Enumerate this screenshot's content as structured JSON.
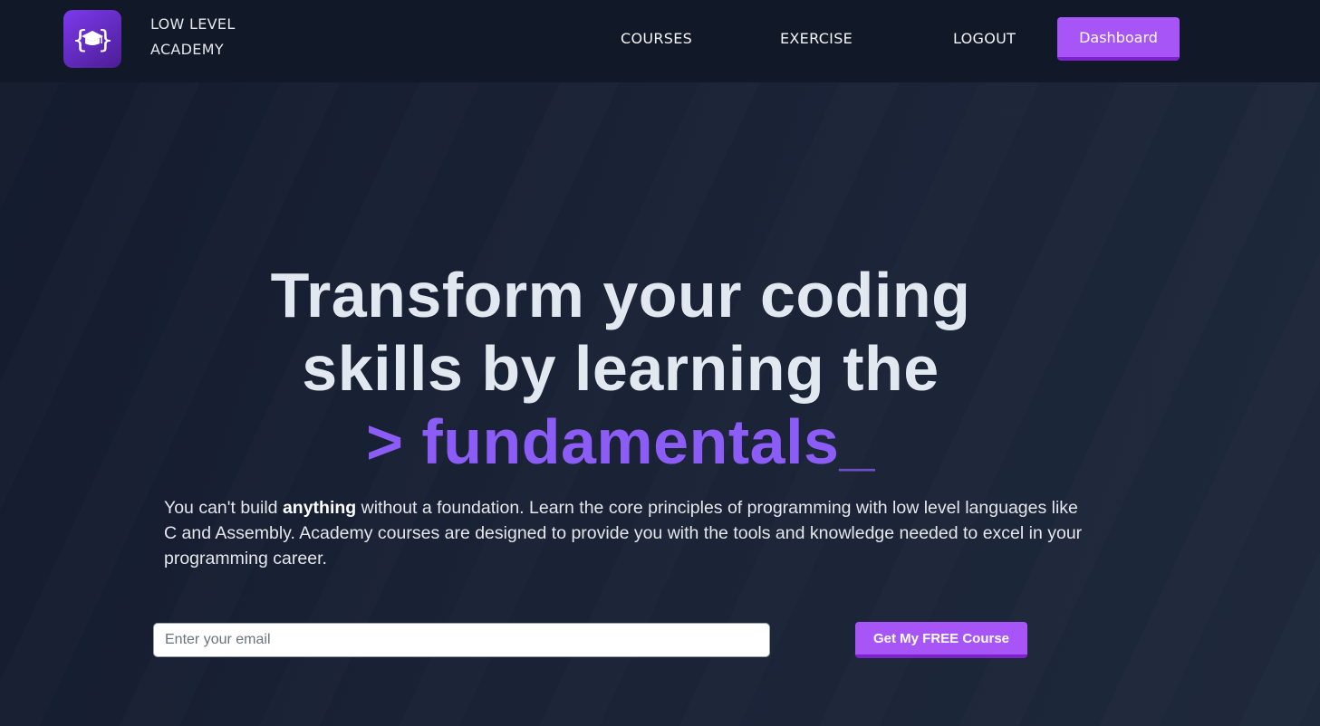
{
  "nav": {
    "brand_line1": "LOW LEVEL",
    "brand_line2": "ACADEMY",
    "logo_icon": "graduation-cap-braces-icon",
    "links": [
      {
        "label": "COURSES"
      },
      {
        "label": "EXERCISE"
      },
      {
        "label": "LOGOUT"
      }
    ],
    "dashboard_label": "Dashboard"
  },
  "hero": {
    "headline_line1": "Transform your coding",
    "headline_line2": "skills by learning the",
    "headline_accent": "> fundamentals",
    "headline_cursor": "_",
    "description_pre": "You can't build ",
    "description_bold": "anything",
    "description_post": " without a foundation. Learn the core principles of programming with low level languages like C and Assembly. Academy courses are designed to provide you with the tools and knowledge needed to excel in your programming career.",
    "email_placeholder": "Enter your email",
    "cta_label": "Get My FREE Course"
  },
  "colors": {
    "accent": "#a855f7",
    "accent_dark": "#7e22ce",
    "headline_accent": "#8b5cf6",
    "nav_bg": "#111827",
    "hero_bg": "#1e293b"
  }
}
